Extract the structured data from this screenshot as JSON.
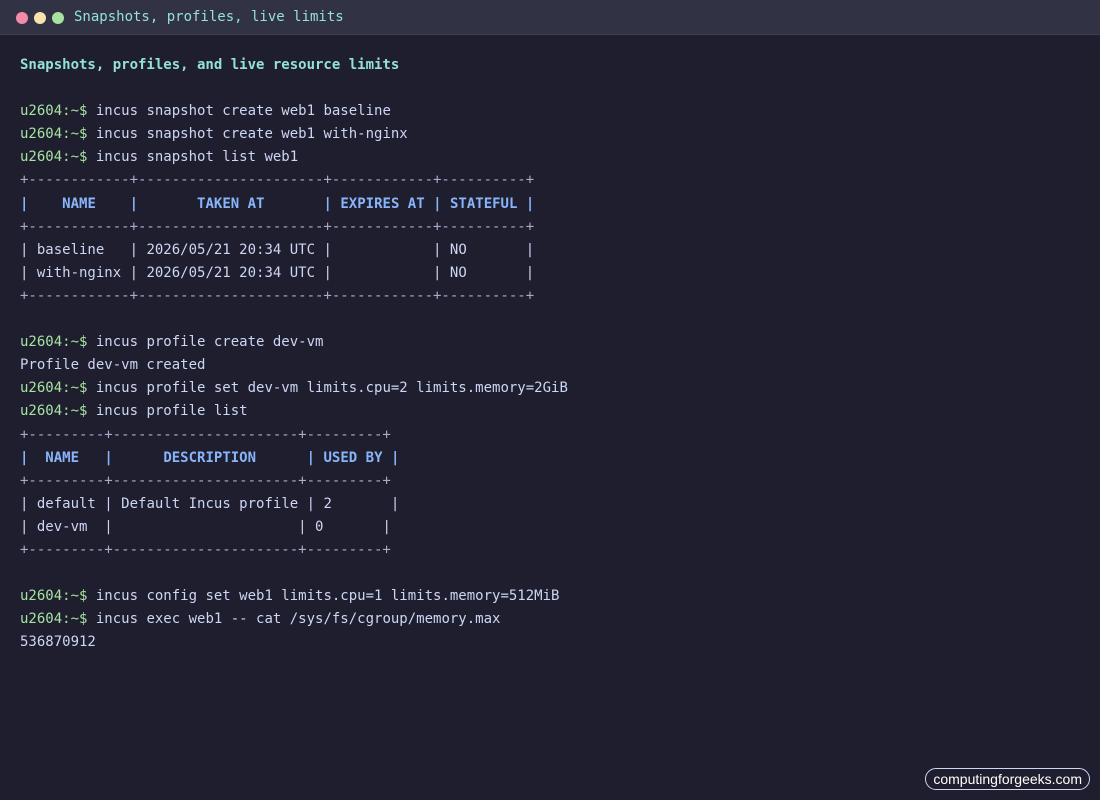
{
  "window": {
    "title": "Snapshots, profiles, live limits"
  },
  "prompt": "u2604:~$",
  "heading": "Snapshots, profiles, and live resource limits",
  "commands": {
    "snap_create_baseline": "incus snapshot create web1 baseline",
    "snap_create_nginx": "incus snapshot create web1 with-nginx",
    "snap_list": "incus snapshot list web1",
    "profile_create": "incus profile create dev-vm",
    "profile_set": "incus profile set dev-vm limits.cpu=2 limits.memory=2GiB",
    "profile_list": "incus profile list",
    "config_set": "incus config set web1 limits.cpu=1 limits.memory=512MiB",
    "exec_cat": "incus exec web1 -- cat /sys/fs/cgroup/memory.max"
  },
  "snapshot_table": {
    "border": "+------------+----------------------+------------+----------+",
    "headers": [
      "NAME",
      "TAKEN AT",
      "EXPIRES AT",
      "STATEFUL"
    ],
    "rows": [
      [
        "baseline",
        "2026/05/21 20:34 UTC",
        "",
        "NO"
      ],
      [
        "with-nginx",
        "2026/05/21 20:34 UTC",
        "",
        "NO"
      ]
    ]
  },
  "profile_created_output": "Profile dev-vm created",
  "profile_table": {
    "border": "+---------+----------------------+---------+",
    "headers": [
      "NAME",
      "DESCRIPTION",
      "USED BY"
    ],
    "rows": [
      [
        "default",
        "Default Incus profile",
        "2"
      ],
      [
        "dev-vm",
        "",
        "0"
      ]
    ]
  },
  "memory_max_output": "536870912",
  "watermark": "computingforgeeks.com",
  "colors": {
    "background": "#1e1e2e",
    "titlebar": "#313244",
    "prompt": "#a6e3a1",
    "heading": "#94e2d5",
    "table_header": "#89b4fa",
    "text": "#cdd6f4"
  }
}
